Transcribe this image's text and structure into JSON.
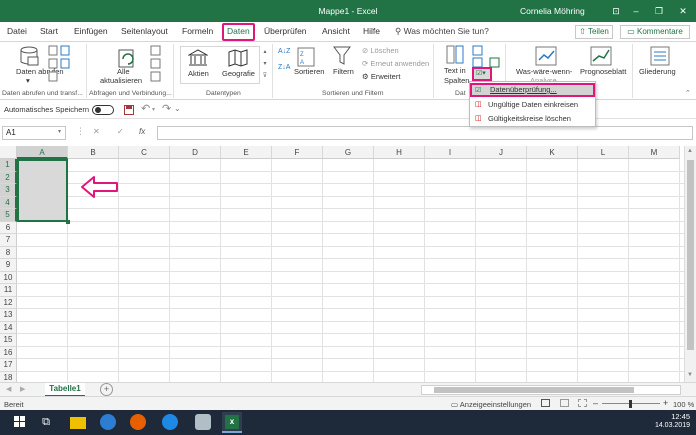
{
  "window": {
    "title": "Mappe1  -  Excel",
    "user": "Cornelia Möhring",
    "minimize": "–",
    "restore": "❐",
    "close": "✕",
    "ribbon_toggle": "⊡"
  },
  "tabs": [
    "Datei",
    "Start",
    "Einfügen",
    "Seitenlayout",
    "Formeln",
    "Daten",
    "Überprüfen",
    "Ansicht",
    "Hilfe"
  ],
  "active_tab": "Daten",
  "tellme": "Was möchten Sie tun?",
  "share": "Teilen",
  "comments": "Kommentare",
  "ribbon": {
    "get_data": "Daten abrufen",
    "get_data_arrow": "▾",
    "refresh_all_line1": "Alle",
    "refresh_all_line2": "aktualisieren",
    "datatypes": [
      "Aktien",
      "Geografie"
    ],
    "sort": "Sortieren",
    "filter": "Filtern",
    "clear": "Löschen",
    "reapply": "Erneut anwenden",
    "advanced": "Erweitert",
    "text_to_columns_line1": "Text in",
    "text_to_columns_line2": "Spalten",
    "whatif_line1": "Was-wäre-wenn-",
    "whatif_line2": "Analyse",
    "forecast": "Prognoseblatt",
    "outline": "Gliederung",
    "groups": {
      "get_transform": "Daten abrufen und transf...",
      "queries": "Abfragen und Verbindung...",
      "datatypes": "Datentypen",
      "sort_filter": "Sortieren und Filtern",
      "datatools": "Dat"
    }
  },
  "qat": {
    "autosave": "Automatisches Speichern",
    "save_icon": "save-icon",
    "undo": "↶",
    "redo": "↷",
    "more": "⌄"
  },
  "formula_bar": {
    "namebox": "A1",
    "cancel": "✕",
    "enter": "✓",
    "fx": "fx",
    "formula": ""
  },
  "grid": {
    "columns": [
      "A",
      "B",
      "C",
      "D",
      "E",
      "F",
      "G",
      "H",
      "I",
      "J",
      "K",
      "L",
      "M"
    ],
    "rows": [
      "1",
      "2",
      "3",
      "4",
      "5",
      "6",
      "7",
      "8",
      "9",
      "10",
      "11",
      "12",
      "13",
      "14",
      "15",
      "16",
      "17",
      "18",
      "19"
    ],
    "selection": "A1:A5",
    "arrow_color": "#e0177a"
  },
  "sheet_tab": "Tabelle1",
  "add_sheet": "+",
  "status": {
    "ready": "Bereit",
    "display_settings": "Anzeigeeinstellungen",
    "zoom": "100 %"
  },
  "dropdown": {
    "items": [
      "Datenüberprüfung...",
      "Ungültige Daten einkreisen",
      "Gültigkeitskreise löschen"
    ],
    "highlighted": 0
  },
  "taskbar": {
    "time": "12:45",
    "date": "14.03.2019"
  },
  "colors": {
    "excel_green": "#217346",
    "highlight_pink": "#e0177a"
  }
}
